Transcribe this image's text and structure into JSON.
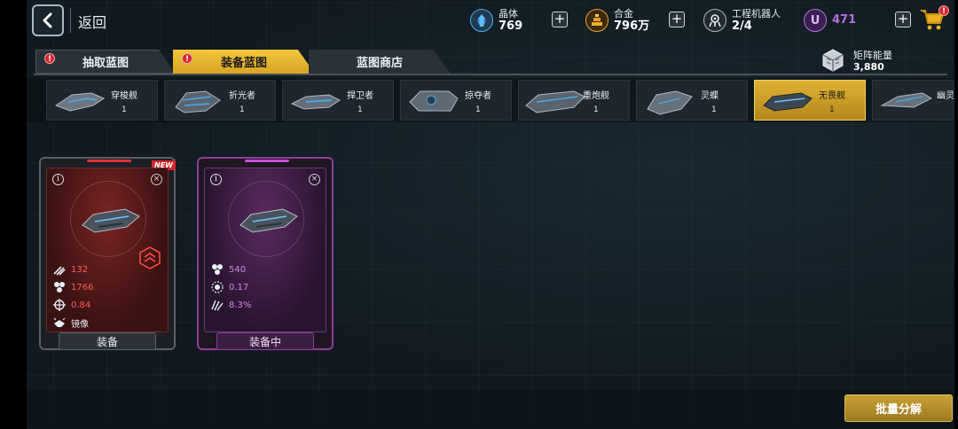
{
  "header": {
    "back_label": "返回",
    "resources": [
      {
        "name": "晶体",
        "value": "769",
        "icon": "crystal-icon",
        "color": "#4aa8e8"
      },
      {
        "name": "合金",
        "value": "796万",
        "icon": "alloy-icon",
        "color": "#e8a020"
      },
      {
        "name": "工程机器人",
        "value": "2/4",
        "icon": "robot-icon",
        "color": "#e8eef4"
      },
      {
        "name": "",
        "value": "471",
        "icon": "u-currency-icon",
        "color": "#b46ee0"
      }
    ],
    "cart_alert": "!"
  },
  "tabs": [
    {
      "label": "抽取蓝图",
      "alert": "!",
      "active": false
    },
    {
      "label": "装备蓝图",
      "alert": "!",
      "active": true
    },
    {
      "label": "蓝图商店",
      "alert": "",
      "active": false
    }
  ],
  "matrix": {
    "name": "矩阵能量",
    "value": "3,880"
  },
  "ships": [
    {
      "name": "穿梭舰",
      "count": "1",
      "selected": false
    },
    {
      "name": "折光者",
      "count": "1",
      "selected": false
    },
    {
      "name": "捍卫者",
      "count": "1",
      "selected": false
    },
    {
      "name": "掠夺者",
      "count": "1",
      "selected": false
    },
    {
      "name": "重炮舰",
      "count": "1",
      "selected": false
    },
    {
      "name": "灵蝶",
      "count": "1",
      "selected": false
    },
    {
      "name": "无畏舰",
      "count": "1",
      "selected": true
    },
    {
      "name": "幽灵",
      "count": "",
      "selected": false
    }
  ],
  "cards": [
    {
      "badge": "NEW",
      "stats": [
        {
          "icon": "speed-icon",
          "value": "132"
        },
        {
          "icon": "cluster-icon",
          "value": "1766"
        },
        {
          "icon": "crosshair-icon",
          "value": "0.84"
        },
        {
          "icon": "mirror-icon",
          "value": "镜像"
        }
      ],
      "button": "装备"
    },
    {
      "badge": "",
      "stats": [
        {
          "icon": "cluster-icon",
          "value": "540"
        },
        {
          "icon": "gear-burst-icon",
          "value": "0.17"
        },
        {
          "icon": "claw-icon",
          "value": "8.3%"
        }
      ],
      "button": "装备中"
    }
  ],
  "batch_button": "批量分解"
}
